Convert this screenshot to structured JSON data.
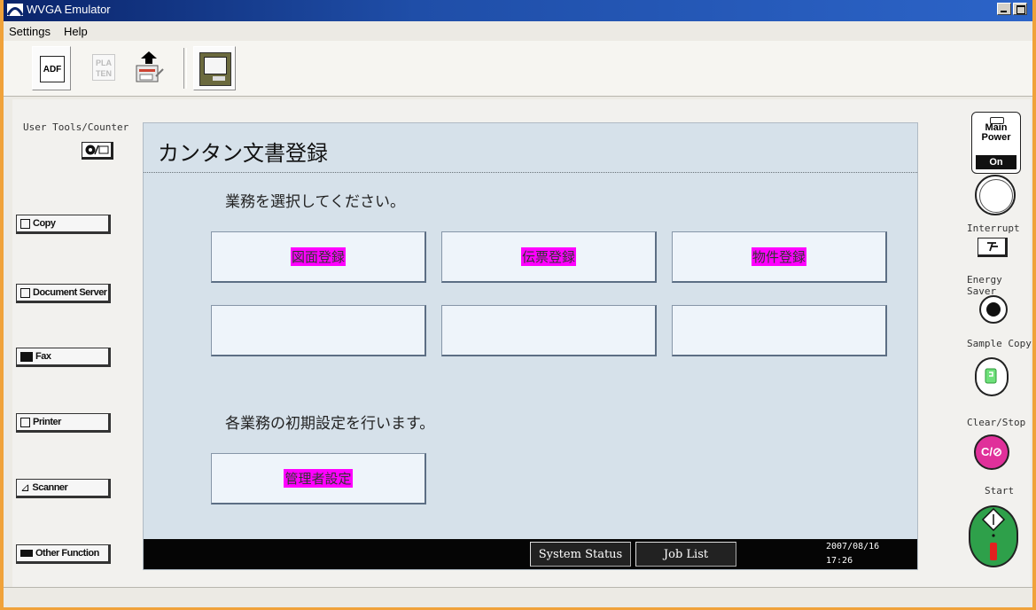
{
  "window": {
    "title": "WVGA Emulator"
  },
  "menu": {
    "settings": "Settings",
    "help": "Help"
  },
  "toolbar": {
    "adf_label": "ADF",
    "platen_label": "PLA TEN"
  },
  "left_panel": {
    "user_tools_label": "User Tools/Counter",
    "copy_label": "Copy",
    "document_server_label": "Document Server",
    "fax_label": "Fax",
    "printer_label": "Printer",
    "scanner_label": "Scanner",
    "other_function_label": "Other Function"
  },
  "screen": {
    "title": "カンタン文書登録",
    "select_prompt": "業務を選択してください。",
    "task_buttons": [
      "図面登録",
      "伝票登録",
      "物件登録"
    ],
    "settings_prompt": "各業務の初期設定を行います。",
    "admin_button": "管理者設定"
  },
  "status_bar": {
    "system_status": "System Status",
    "job_list": "Job List",
    "date": "2007/08/16",
    "time": "17:26"
  },
  "right_panel": {
    "main_power_line1": "Main",
    "main_power_line2": "Power",
    "main_power_state": "On",
    "interrupt_label": "Interrupt",
    "energy_saver_label": "Energy Saver",
    "sample_copy_label": "Sample Copy",
    "clear_stop_label": "Clear/Stop",
    "clear_stop_glyph": "C/⊘",
    "start_label": "Start"
  },
  "colors": {
    "highlight": "#ff00ff",
    "screen_bg": "#d6e1ea",
    "clear_stop": "#e0309a",
    "start": "#2ea04a"
  }
}
